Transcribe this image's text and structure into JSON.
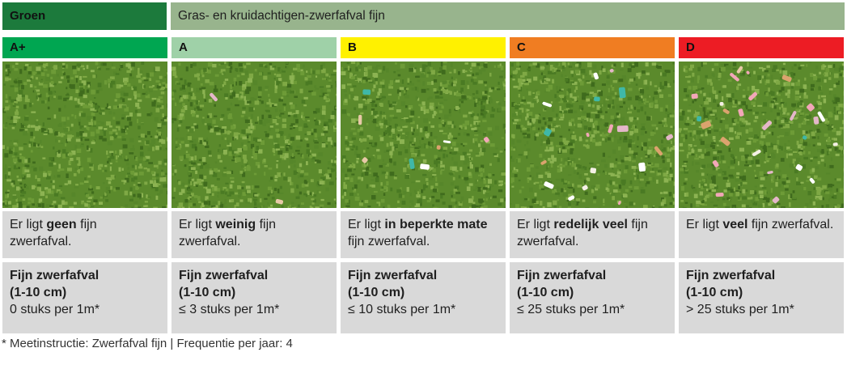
{
  "header": {
    "category": "Groen",
    "title": "Gras- en kruidachtigen-zwerfafval fijn"
  },
  "colors": {
    "category_bg": "#1c7a3c",
    "title_bg": "#98b48d",
    "cell_bg": "#d9d9d9"
  },
  "columns": [
    {
      "grade": "A+",
      "color": "#00a651",
      "desc_pre": "Er ligt ",
      "desc_bold": "geen",
      "desc_post": " fijn zwerfafval.",
      "spec_title_1": "Fijn zwerfafval",
      "spec_title_2": "(1-10 cm)",
      "spec_value": "0 stuks per 1m*",
      "litter_level": 0
    },
    {
      "grade": "A",
      "color": "#9fd1a8",
      "desc_pre": "Er ligt ",
      "desc_bold": "weinig",
      "desc_post": " fijn zwerfafval.",
      "spec_title_1": "Fijn zwerfafval",
      "spec_title_2": "(1-10 cm)",
      "spec_value": "≤ 3 stuks per 1m*",
      "litter_level": 1
    },
    {
      "grade": "B",
      "color": "#fff100",
      "desc_pre": "Er ligt ",
      "desc_bold": "in beperkte mate",
      "desc_post": " fijn zwerfafval.",
      "spec_title_1": "Fijn zwerfafval",
      "spec_title_2": "(1-10 cm)",
      "spec_value": "≤ 10 stuks per 1m*",
      "litter_level": 2
    },
    {
      "grade": "C",
      "color": "#f07d22",
      "desc_pre": "Er ligt ",
      "desc_bold": "redelijk veel",
      "desc_post": " fijn zwerfafval.",
      "spec_title_1": "Fijn zwerfafval",
      "spec_title_2": "(1-10 cm)",
      "spec_value": "≤ 25 stuks per 1m*",
      "litter_level": 3
    },
    {
      "grade": "D",
      "color": "#ed1c24",
      "desc_pre": "Er ligt ",
      "desc_bold": "veel",
      "desc_post": " fijn zwerfafval.",
      "spec_title_1": "Fijn zwerfafval",
      "spec_title_2": "(1-10 cm)",
      "spec_value": "> 25 stuks per 1m*",
      "litter_level": 4
    }
  ],
  "footnote": "* Meetinstructie: Zwerfafval fijn | Frequentie per jaar: 4"
}
